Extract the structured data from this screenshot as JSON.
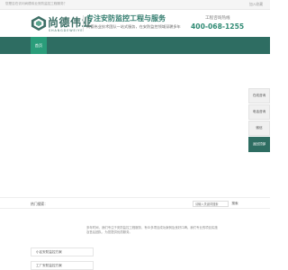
{
  "topbar": {
    "welcome": "您是否在访问尚德伟业安防监控工程服务？",
    "favorite": "加入收藏"
  },
  "header": {
    "logo_cn": "尚德伟业",
    "logo_en": "SHANGDEWEIYE",
    "slogan": "专注安防监控工程与服务",
    "subslogan": "尚德伟业技术团队一站式服务，在安防监控领域深耕多年",
    "hotline_label": "工程咨询热线",
    "hotline": "400-068-1255"
  },
  "nav": {
    "home": "首页"
  },
  "side_panel": {
    "items": [
      {
        "label": "在线咨询"
      },
      {
        "label": "电话咨询"
      },
      {
        "label": "微信"
      },
      {
        "label": "返回顶部"
      }
    ]
  },
  "hotbar": {
    "label": "热门搜索：",
    "search_placeholder": "请输入关键词搜索",
    "search_button": "搜索"
  },
  "content": {
    "intro": "多年时间，我们专注于安防监控工程服务，有众多项目成功案例及良好口碑。我们专业的项目实施及售后团队，为您提供优质服务。",
    "cases": [
      {
        "label": "小区安防监控方案"
      },
      {
        "label": "工厂安防监控方案"
      }
    ]
  }
}
